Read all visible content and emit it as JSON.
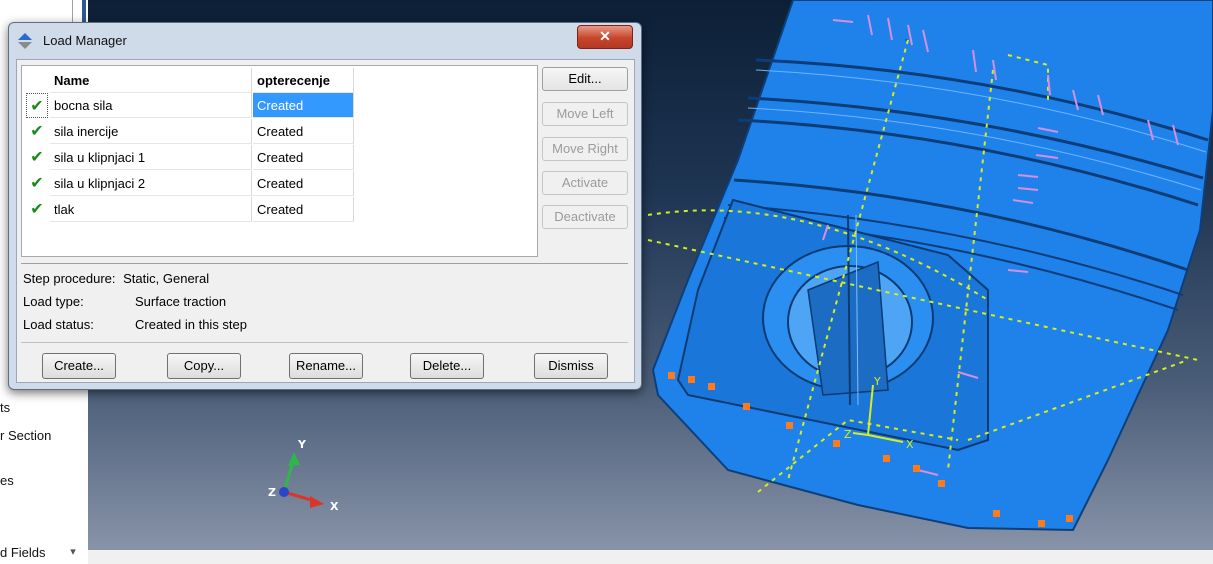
{
  "model_tree": {
    "items": [
      {
        "label": "ts"
      },
      {
        "label": "r Section"
      },
      {
        "label": "es"
      },
      {
        "label": "d Fields"
      }
    ],
    "scroll_glyph": "▾"
  },
  "viewport": {
    "triad_labels": {
      "x": "X",
      "y": "Y",
      "z": "Z"
    },
    "model_csys_labels": {
      "x": "X",
      "y": "Y",
      "z": "Z"
    },
    "colors": {
      "part": "#1e7fe6",
      "load_arrows": "#d48fe0",
      "bc_markers": "#ff7a1a",
      "datum_lines": "#d4ef1e"
    }
  },
  "dialog": {
    "title": "Load Manager",
    "close_glyph": "✕",
    "columns": {
      "name": "Name",
      "step": "opterecenje"
    },
    "rows": [
      {
        "name": "bocna sila",
        "status": "Created",
        "selected": true
      },
      {
        "name": "sila inercije",
        "status": "Created",
        "selected": false
      },
      {
        "name": "sila u klipnjaci 1",
        "status": "Created",
        "selected": false
      },
      {
        "name": "sila u klipnjaci 2",
        "status": "Created",
        "selected": false
      },
      {
        "name": "tlak",
        "status": "Created",
        "selected": false
      }
    ],
    "check_glyph": "✔",
    "side_buttons": {
      "edit": "Edit...",
      "move_left": "Move Left",
      "move_right": "Move Right",
      "activate": "Activate",
      "deactivate": "Deactivate"
    },
    "info": {
      "step_procedure_label": "Step procedure:",
      "step_procedure_value": "Static, General",
      "load_type_label": "Load type:",
      "load_type_value": "Surface traction",
      "load_status_label": "Load status:",
      "load_status_value": "Created in this step"
    },
    "bottom_buttons": {
      "create": "Create...",
      "copy": "Copy...",
      "rename": "Rename...",
      "delete": "Delete...",
      "dismiss": "Dismiss"
    }
  }
}
